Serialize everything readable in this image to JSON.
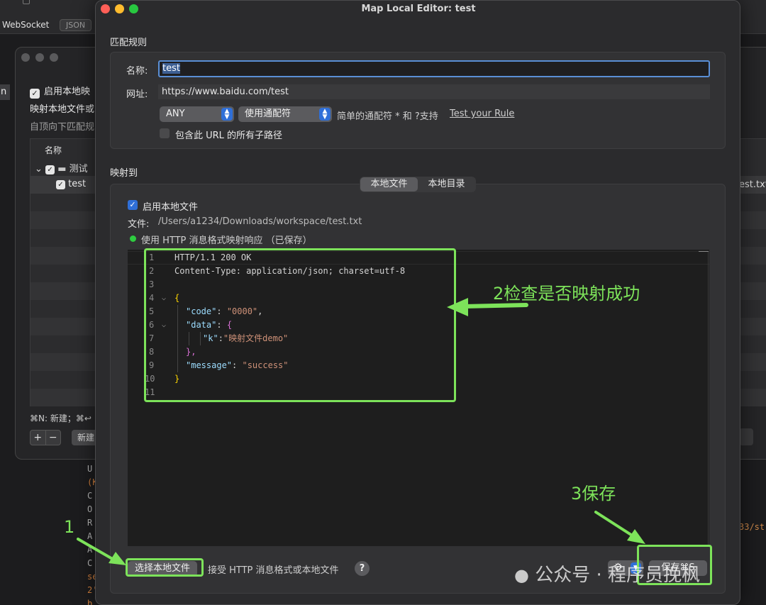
{
  "background": {
    "top_tabs": {
      "websocket": "WebSocket",
      "json": "JSON"
    },
    "list_window": {
      "enable_label": "启用本地映",
      "map_label": "映射本地文件或",
      "desc": "自顶向下匹配规",
      "column_name": "名称",
      "group_row": "测试",
      "item_row": "test",
      "shortcut_hint": "⌘N: 新建；⌘↩",
      "plus": "+",
      "minus": "−",
      "new_button": "新建"
    },
    "right_peek": {
      "file_text": "est.txt",
      "number_text": "33/st"
    },
    "left_edge_text": "n",
    "log_lines": [
      "U",
      "(K",
      "C",
      "O",
      "R",
      "A",
      "A",
      "C",
      "se",
      "2'",
      "b"
    ]
  },
  "dialog": {
    "title": "Map Local Editor: test",
    "match_rule": {
      "section_label": "匹配规则",
      "name_label": "名称:",
      "name_value": "test",
      "url_label": "网址:",
      "url_value": "https://www.baidu.com/test",
      "method_select": "ANY",
      "match_select": "使用通配符",
      "wildcard_hint": "简单的通配符 * 和 ?支持",
      "test_rule_link": "Test your Rule",
      "include_subpaths_label": "包含此 URL 的所有子路径",
      "include_subpaths_checked": false
    },
    "map_to": {
      "section_label": "映射到",
      "tabs": [
        "本地文件",
        "本地目录"
      ],
      "active_tab": "本地文件",
      "enable_label": "启用本地文件",
      "enable_checked": true,
      "file_label": "文件:",
      "file_path": "/Users/a1234/Downloads/workspace/test.txt",
      "status_text": "使用 HTTP 消息格式映射响应 （已保存）",
      "status_color": "#2ecc40"
    },
    "editor": {
      "line_numbers": [
        "1",
        "2",
        "3",
        "4",
        "5",
        "6",
        "7",
        "8",
        "9",
        "10",
        "11"
      ],
      "line1": "HTTP/1.1 200 OK",
      "line2": "Content-Type: application/json; charset=utf-8",
      "open_brace": "{",
      "code_key": "\"code\"",
      "code_value": "\"0000\"",
      "data_key": "\"data\"",
      "k_key": "\"k\"",
      "k_value": "\"映射文件demo\"",
      "message_key": "\"message\"",
      "message_value": "\"success\"",
      "close_brace": "}",
      "inner_open": "{",
      "inner_close": "},",
      "colon": ": ",
      "comma": ",",
      "tight_colon": ":"
    },
    "footer": {
      "choose_button": "选择本地文件",
      "accept_text": "接受 HTTP 消息格式或本地文件",
      "help": "?",
      "save_button": "保存⌘S"
    }
  },
  "annotations": {
    "step1": "1",
    "step2": "2检查是否映射成功",
    "step3": "3保存",
    "color": "#7de35a"
  },
  "watermark": "公众号 · 程序员挽枫"
}
